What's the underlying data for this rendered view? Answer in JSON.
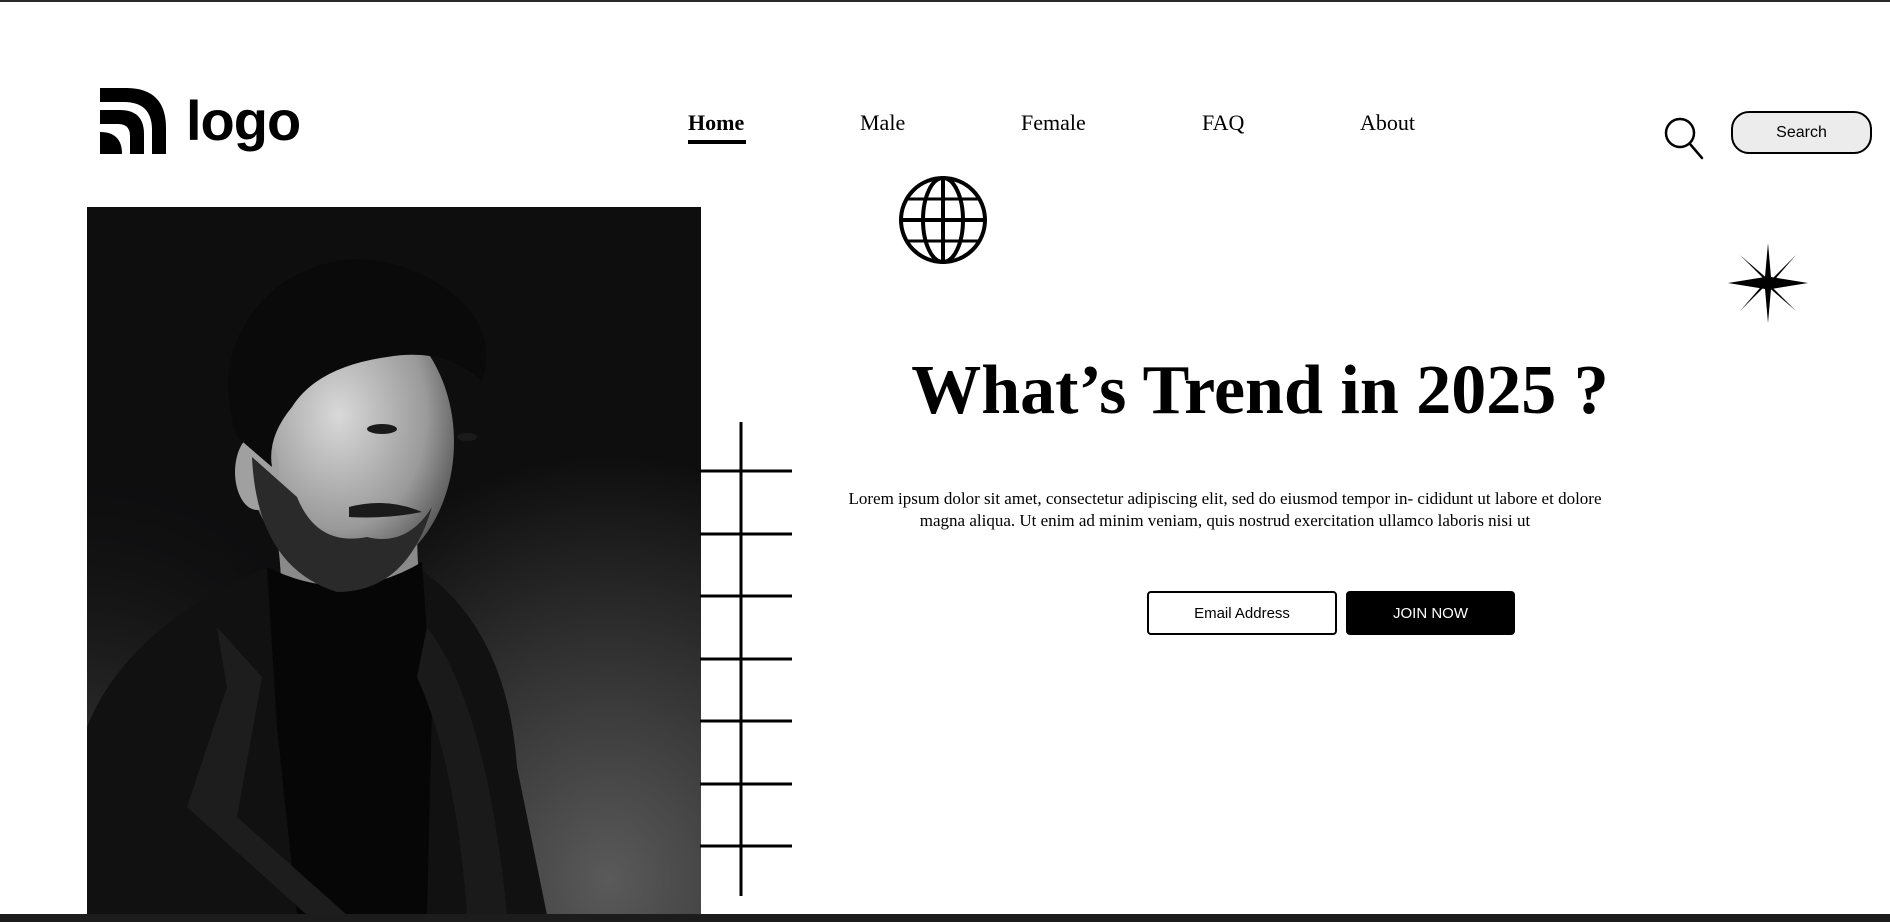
{
  "brand": {
    "logo_text": "logo",
    "logo_icon": "wifi-arcs-logo-icon"
  },
  "nav": {
    "items": [
      {
        "label": "Home",
        "active": true
      },
      {
        "label": "Male",
        "active": false
      },
      {
        "label": "Female",
        "active": false
      },
      {
        "label": "FAQ",
        "active": false
      },
      {
        "label": "About",
        "active": false
      }
    ]
  },
  "search": {
    "icon": "search-icon",
    "button_label": "Search"
  },
  "hero": {
    "photo": "portrait-photo",
    "headline": "What’s Trend in 2025 ?",
    "lede": "Lorem ipsum dolor sit amet, consectetur adipiscing elit, sed do eiusmod tempor in- cididunt ut labore et dolore magna aliqua. Ut enim ad minim veniam, quis nostrud exercitation ullamco laboris nisi ut",
    "decorations": [
      "globe-icon",
      "sparkle-icon",
      "ladder-lines"
    ]
  },
  "signup": {
    "email_placeholder": "Email Address",
    "email_value": "",
    "join_label": "JOIN NOW"
  },
  "colors": {
    "background": "#ffffff",
    "text": "#000000",
    "search_button_bg": "#ececec",
    "join_button_bg": "#000000",
    "join_button_text": "#ffffff"
  }
}
